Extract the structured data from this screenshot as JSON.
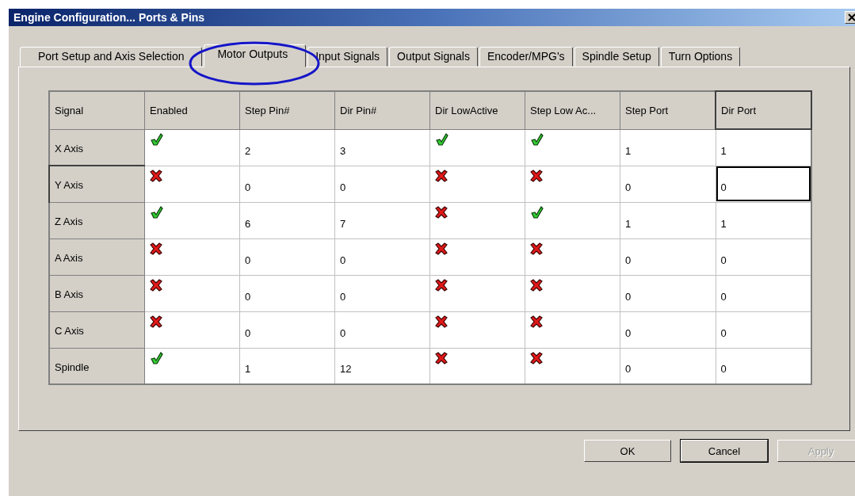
{
  "window": {
    "title": "Engine Configuration... Ports & Pins"
  },
  "tabs": [
    {
      "label": "Port Setup and Axis Selection",
      "selected": false
    },
    {
      "label": "Motor Outputs",
      "selected": true
    },
    {
      "label": "Input Signals",
      "selected": false
    },
    {
      "label": "Output Signals",
      "selected": false
    },
    {
      "label": "Encoder/MPG's",
      "selected": false
    },
    {
      "label": "Spindle Setup",
      "selected": false
    },
    {
      "label": "Turn Options",
      "selected": false
    }
  ],
  "annotation": {
    "kind": "ellipse"
  },
  "table": {
    "columns": [
      {
        "label": "Signal",
        "kind": "header",
        "selected": false
      },
      {
        "label": "Enabled",
        "kind": "flag",
        "selected": false
      },
      {
        "label": "Step Pin#",
        "kind": "text",
        "selected": false
      },
      {
        "label": "Dir Pin#",
        "kind": "text",
        "selected": false
      },
      {
        "label": "Dir LowActive",
        "kind": "flag",
        "selected": false
      },
      {
        "label": "Step Low Ac...",
        "kind": "flag",
        "selected": false
      },
      {
        "label": "Step Port",
        "kind": "text",
        "selected": false
      },
      {
        "label": "Dir Port",
        "kind": "text",
        "selected": true
      }
    ],
    "rows": [
      {
        "selected": false,
        "cells": [
          "X Axis",
          true,
          "2",
          "3",
          true,
          true,
          "1",
          "1"
        ]
      },
      {
        "selected": true,
        "cells": [
          "Y Axis",
          false,
          "0",
          "0",
          false,
          false,
          "0",
          "0"
        ]
      },
      {
        "selected": false,
        "cells": [
          "Z Axis",
          true,
          "6",
          "7",
          false,
          true,
          "1",
          "1"
        ]
      },
      {
        "selected": false,
        "cells": [
          "A Axis",
          false,
          "0",
          "0",
          false,
          false,
          "0",
          "0"
        ]
      },
      {
        "selected": false,
        "cells": [
          "B Axis",
          false,
          "0",
          "0",
          false,
          false,
          "0",
          "0"
        ]
      },
      {
        "selected": false,
        "cells": [
          "C Axis",
          false,
          "0",
          "0",
          false,
          false,
          "0",
          "0"
        ]
      },
      {
        "selected": false,
        "cells": [
          "Spindle",
          true,
          "1",
          "12",
          false,
          false,
          "0",
          "0"
        ]
      }
    ]
  },
  "buttons": [
    {
      "label": "OK",
      "disabled": false,
      "default": false
    },
    {
      "label": "Cancel",
      "disabled": false,
      "default": true
    },
    {
      "label": "Apply",
      "disabled": true,
      "default": false
    }
  ]
}
